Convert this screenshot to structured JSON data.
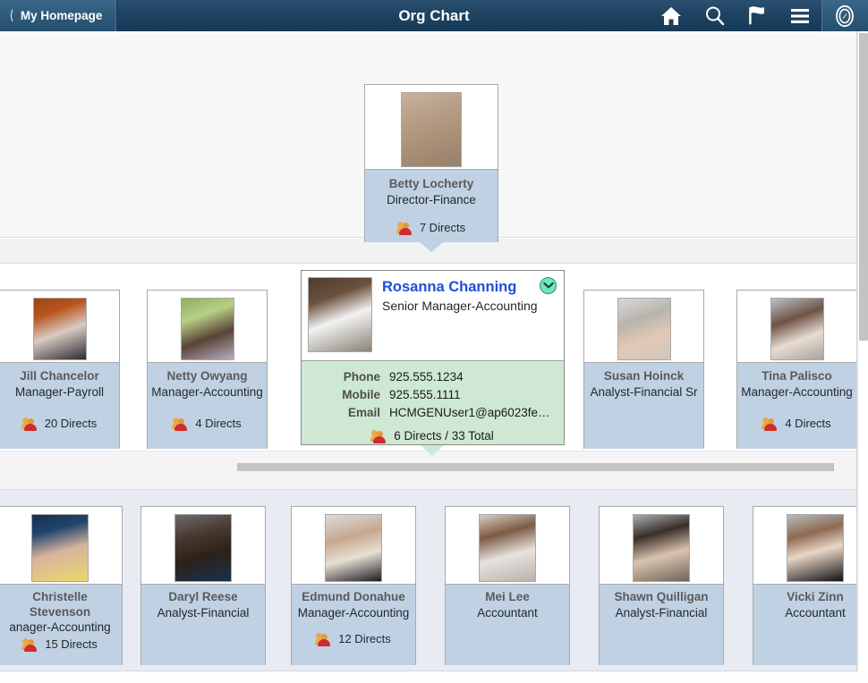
{
  "header": {
    "back_label": "My Homepage",
    "back_icon": "chevron-left-icon",
    "title": "Org Chart",
    "icons": [
      {
        "name": "home-icon",
        "label": "Home"
      },
      {
        "name": "search-icon",
        "label": "Search"
      },
      {
        "name": "flag-icon",
        "label": "Notifications"
      },
      {
        "name": "hamburger-menu-icon",
        "label": "Actions"
      },
      {
        "name": "navbar-compass-icon",
        "label": "NavBar"
      }
    ],
    "colors": {
      "bar": "#1f4261",
      "button": "#2d5878",
      "text": "#ffffff"
    }
  },
  "org_chart": {
    "manager_level": {
      "card": {
        "name": "Betty Locherty",
        "title": "Director-Finance",
        "directs": "7 Directs",
        "directs_icon": "people-icon"
      }
    },
    "peer_level": [
      {
        "name": "Jill Chancelor",
        "title": "Manager-Payroll",
        "directs": "20 Directs",
        "directs_icon": "people-icon"
      },
      {
        "name": "Netty Owyang",
        "title": "Manager-Accounting",
        "directs": "4 Directs",
        "directs_icon": "people-icon"
      },
      {
        "name": "Susan Hoinck",
        "title": "Analyst-Financial Sr",
        "directs": "",
        "directs_icon": "people-icon"
      },
      {
        "name": "Tina Palisco",
        "title": "Manager-Accounting",
        "directs": "4 Directs",
        "directs_icon": "people-icon"
      }
    ],
    "focus_card": {
      "name": "Rosanna Channing",
      "title": "Senior Manager-Accounting",
      "expand_icon": "chevron-down-circle-icon",
      "details": [
        {
          "label": "Phone",
          "value": "925.555.1234"
        },
        {
          "label": "Mobile",
          "value": "925.555.1111"
        },
        {
          "label": "Email",
          "value": "HCMGENUser1@ap6023fe…"
        }
      ],
      "directs": "6 Directs / 33 Total",
      "directs_icon": "people-icon",
      "highlight_color": "#cfe8d3"
    },
    "direct_reports": [
      {
        "name": "Christelle Stevenson",
        "name_line1": "Christelle",
        "name_line2": "Stevenson",
        "title": "anager-Accounting",
        "directs": "15 Directs",
        "directs_icon": "people-icon"
      },
      {
        "name": "Daryl Reese",
        "name_line1": "Daryl Reese",
        "name_line2": "",
        "title": "Analyst-Financial",
        "directs": "",
        "directs_icon": "people-icon"
      },
      {
        "name": "Edmund Donahue",
        "name_line1": "Edmund Donahue",
        "name_line2": "",
        "title": "Manager-Accounting",
        "directs": "12 Directs",
        "directs_icon": "people-icon"
      },
      {
        "name": "Mei Lee",
        "name_line1": "Mei Lee",
        "name_line2": "",
        "title": "Accountant",
        "directs": "",
        "directs_icon": "people-icon"
      },
      {
        "name": "Shawn Quilligan",
        "name_line1": "Shawn Quilligan",
        "name_line2": "",
        "title": "Analyst-Financial",
        "directs": "",
        "directs_icon": "people-icon"
      },
      {
        "name": "Vicki Zinn",
        "name_line1": "Vicki Zinn",
        "name_line2": "",
        "title": "Accountant",
        "directs": "",
        "directs_icon": "people-icon"
      }
    ]
  },
  "scrollbars": {
    "vertical": "vertical-scrollbar",
    "horizontal_peer_row": "horizontal-scrollbar-peer-row",
    "horizontal_reports_row": "horizontal-scrollbar-reports-row"
  }
}
